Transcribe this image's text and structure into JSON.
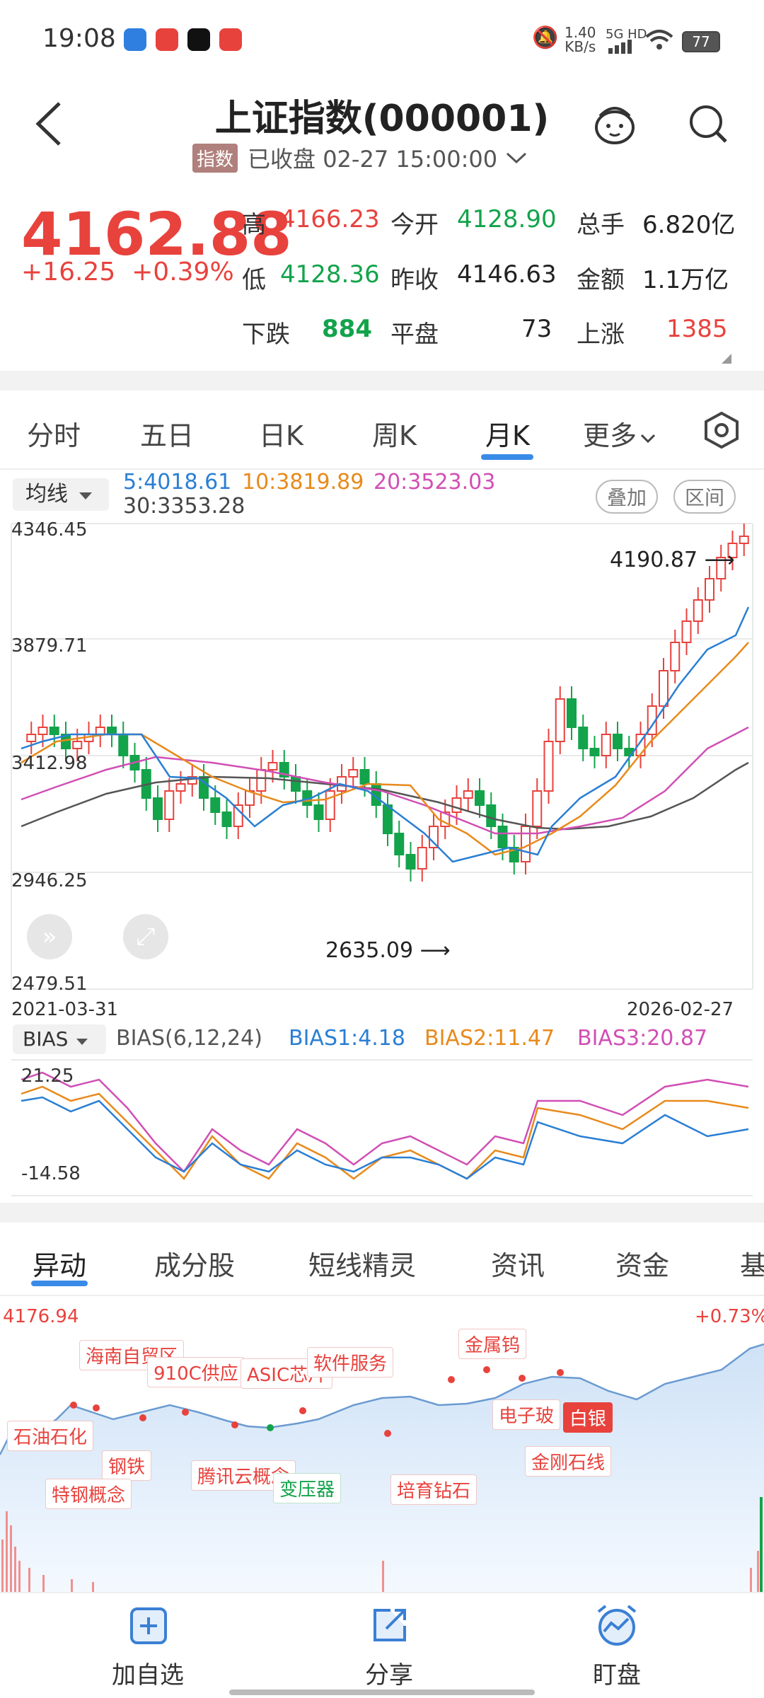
{
  "status_bar": {
    "time": "19:08",
    "speed": "1.40",
    "speed_unit": "KB/s",
    "network": "5G HD",
    "battery": "77"
  },
  "header": {
    "title": "上证指数(000001)",
    "tag": "指数",
    "status": "已收盘 02-27 15:00:00"
  },
  "quote": {
    "price": "4162.88",
    "change": "+16.25",
    "change_pct": "+0.39%",
    "high_label": "高",
    "high": "4166.23",
    "low_label": "低",
    "low": "4128.36",
    "open_label": "今开",
    "open": "4128.90",
    "prev_label": "昨收",
    "prev": "4146.63",
    "vol_label": "总手",
    "vol": "6.820亿",
    "amt_label": "金额",
    "amt": "1.1万亿",
    "down_label": "下跌",
    "down": "884",
    "flat_label": "平盘",
    "flat": "73",
    "up_label": "上涨",
    "up": "1385"
  },
  "chart_tabs": [
    "分时",
    "五日",
    "日K",
    "周K",
    "月K",
    "更多"
  ],
  "kline": {
    "ma_selector": "均线",
    "ma5": "5:4018.61",
    "ma10": "10:3819.89",
    "ma20": "20:3523.03",
    "ma30": "30:3353.28",
    "overlay_btn": "叠加",
    "range_btn": "区间",
    "y_labels": [
      "4346.45",
      "3879.71",
      "3412.98",
      "2946.25",
      "2479.51"
    ],
    "high_note": "4190.87",
    "low_note": "2635.09",
    "date_start": "2021-03-31",
    "date_end": "2026-02-27"
  },
  "bias": {
    "selector": "BIAS",
    "name": "BIAS(6,12,24)",
    "b1": "BIAS1:4.18",
    "b2": "BIAS2:11.47",
    "b3": "BIAS3:20.87",
    "top": "21.25",
    "bottom": "-14.58"
  },
  "bottom_tabs": [
    "异动",
    "成分股",
    "短线精灵",
    "资讯",
    "资金",
    "基"
  ],
  "intraday": {
    "top_value": "4176.94",
    "top_pct": "+0.73%",
    "events": [
      "海南自贸区",
      "910C供应",
      "ASIC芯片",
      "软件服务",
      "金属钨",
      "石油石化",
      "钢铁",
      "特钢概念",
      "腾讯云概念",
      "变压器",
      "培育钻石",
      "电子玻",
      "白银",
      "金刚石线"
    ]
  },
  "nav": {
    "add": "加自选",
    "share": "分享",
    "watch": "盯盘"
  },
  "chart_data": {
    "type": "candlestick",
    "title": "上证指数(000001) 月K",
    "x_range": [
      "2021-03-31",
      "2026-02-27"
    ],
    "ylim": [
      2479.51,
      4346.45
    ],
    "y_ticks": [
      4346.45,
      3879.71,
      3412.98,
      2946.25,
      2479.51
    ],
    "annotations": [
      {
        "label": "high",
        "value": 4190.87
      },
      {
        "label": "low",
        "value": 2635.09
      }
    ],
    "moving_averages": [
      {
        "name": "MA5",
        "value": 4018.61
      },
      {
        "name": "MA10",
        "value": 3819.89
      },
      {
        "name": "MA20",
        "value": 3523.03
      },
      {
        "name": "MA30",
        "value": 3353.28
      }
    ],
    "bias": [
      {
        "name": "BIAS1",
        "value": 4.18
      },
      {
        "name": "BIAS2",
        "value": 11.47
      },
      {
        "name": "BIAS3",
        "value": 20.87
      }
    ],
    "bias_ylim": [
      -14.58,
      21.25
    ]
  }
}
